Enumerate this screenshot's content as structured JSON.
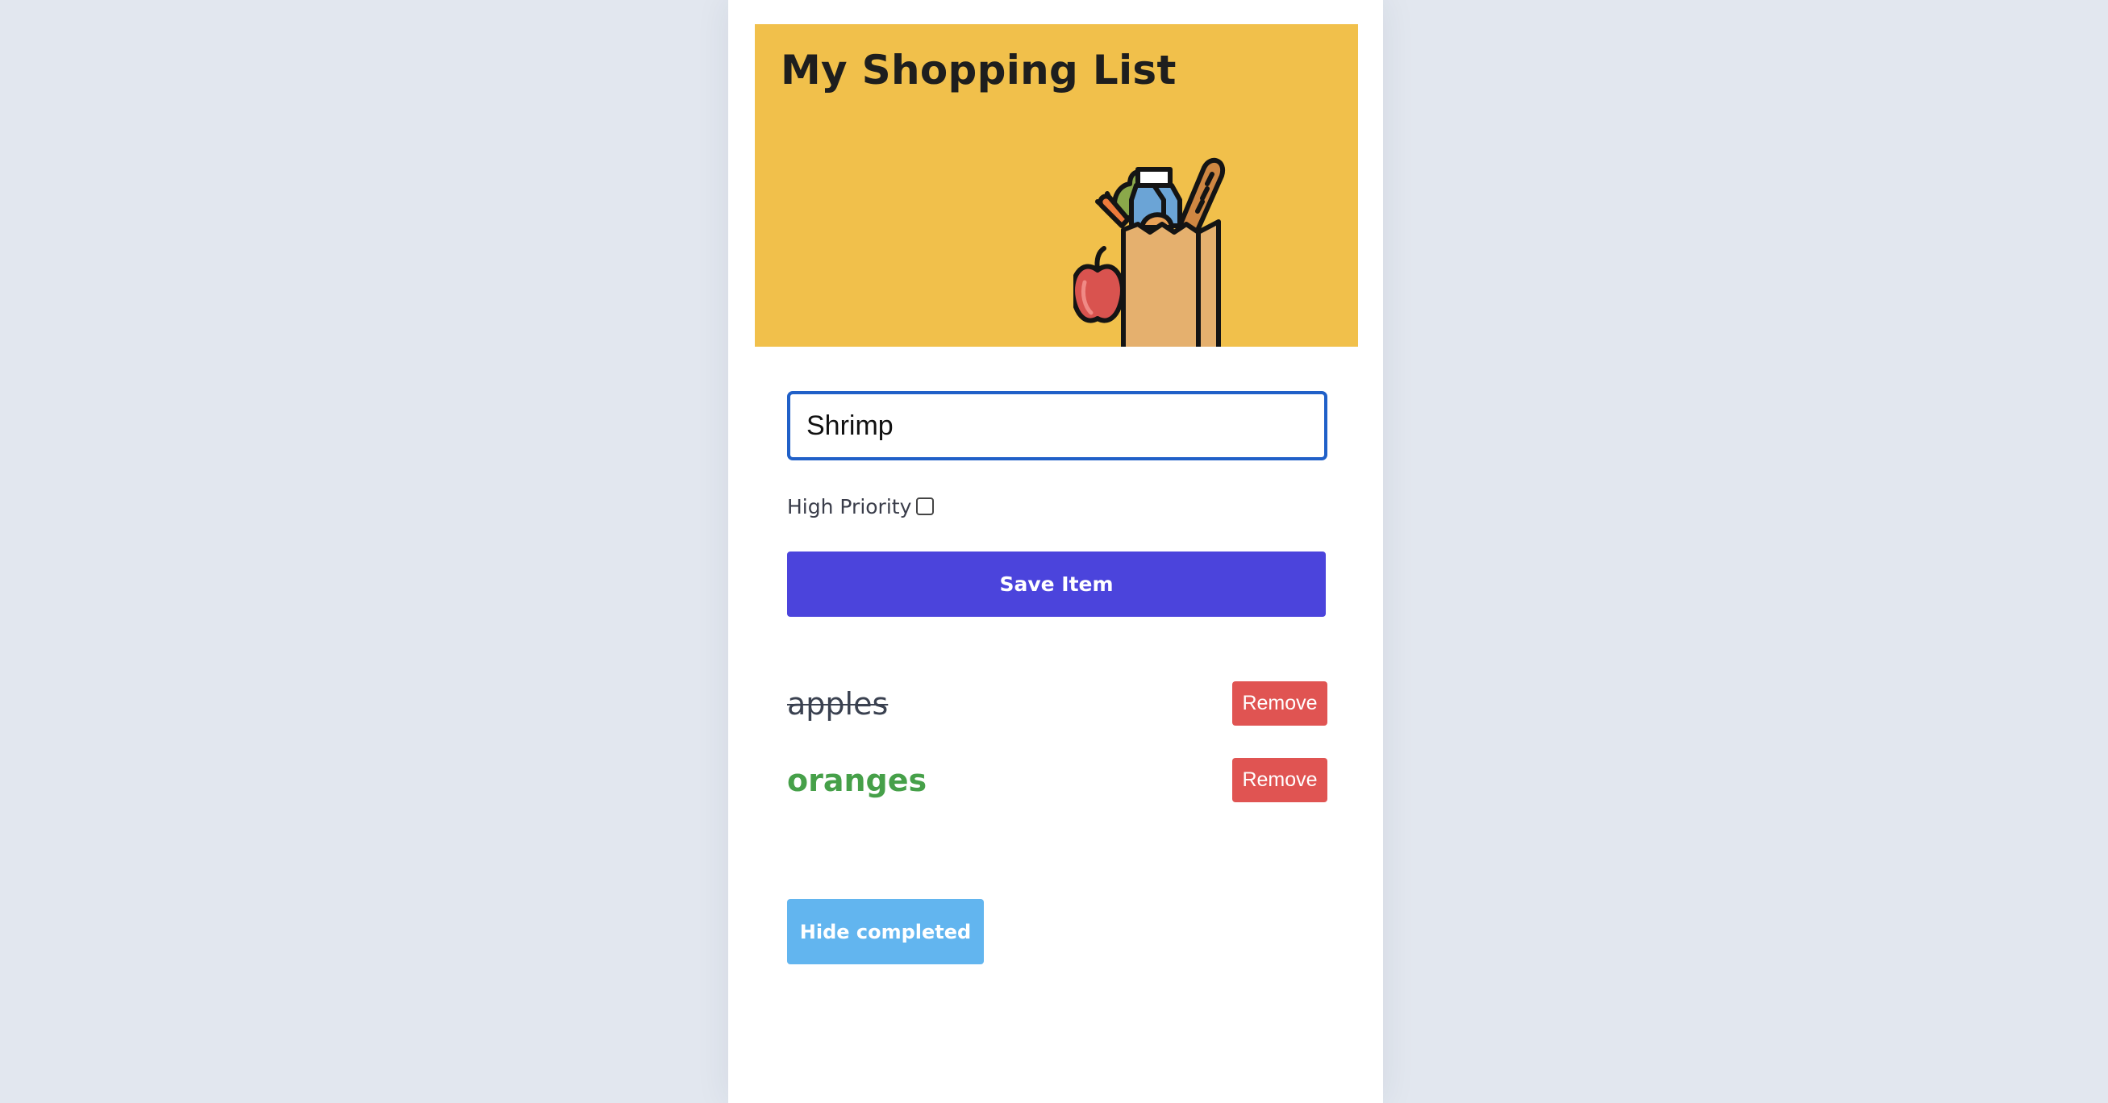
{
  "header": {
    "title": "My Shopping List",
    "illustration": "grocery-bag-illustration",
    "background_color": "#f1c04b"
  },
  "form": {
    "item_input_value": "Shrimp",
    "priority_label": "High Priority",
    "priority_checked": false,
    "save_label": "Save Item"
  },
  "items": [
    {
      "name": "apples",
      "status": "completed",
      "remove_label": "Remove"
    },
    {
      "name": "oranges",
      "status": "high-priority",
      "remove_label": "Remove"
    }
  ],
  "footer": {
    "hide_completed_label": "Hide completed"
  },
  "colors": {
    "page_background": "#e2e7ef",
    "primary_button": "#4b44dc",
    "remove_button": "#e05452",
    "secondary_button": "#62b5ef",
    "priority_text": "#46a049",
    "input_focus_border": "#2060c8"
  }
}
